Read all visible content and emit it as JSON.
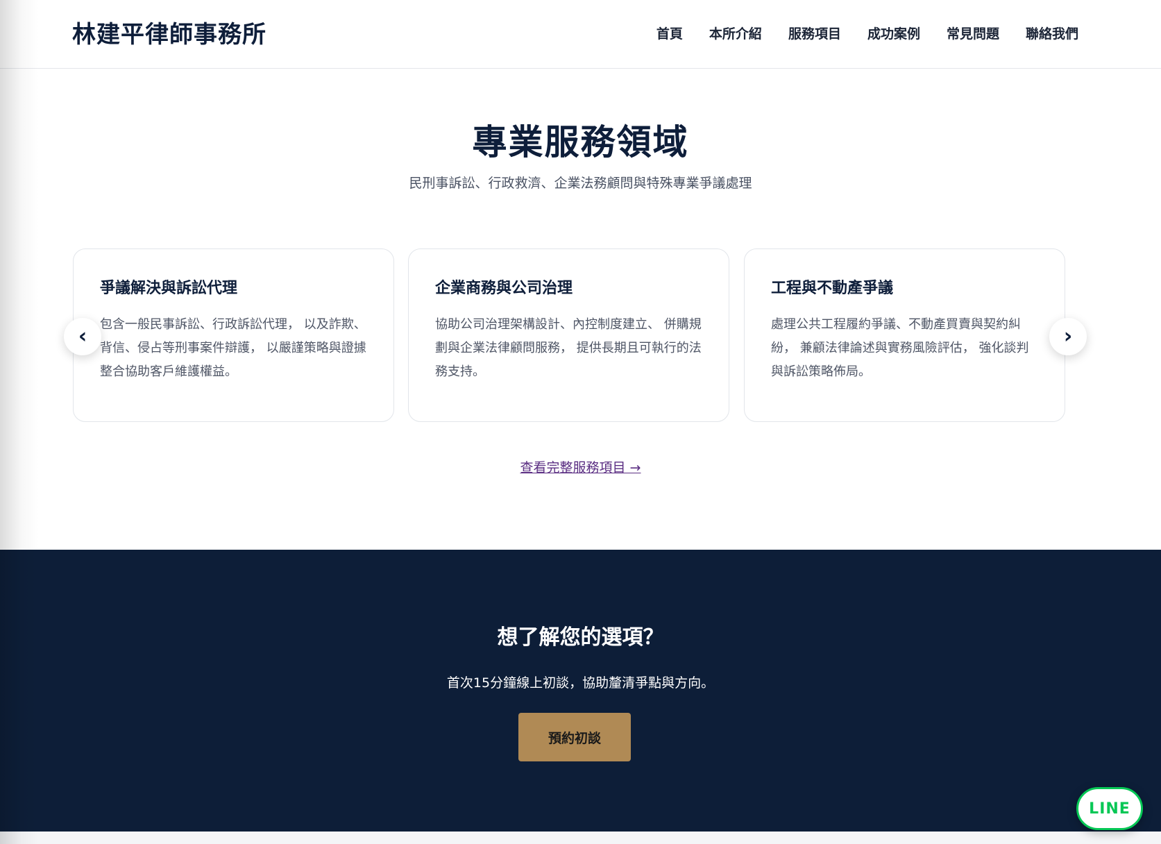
{
  "header": {
    "brand": "林建平律師事務所",
    "nav": [
      {
        "label": "首頁"
      },
      {
        "label": "本所介紹"
      },
      {
        "label": "服務項目"
      },
      {
        "label": "成功案例"
      },
      {
        "label": "常見問題"
      },
      {
        "label": "聯絡我們"
      }
    ]
  },
  "services": {
    "title": "專業服務領域",
    "subtitle": "民刑事訴訟、行政救濟、企業法務顧問與特殊專業爭議處理",
    "cards": [
      {
        "title": "爭議解決與訴訟代理",
        "description": "包含一般民事訴訟、行政訴訟代理， 以及詐欺、背信、侵占等刑事案件辯護， 以嚴謹策略與證據整合協助客戶維護權益。"
      },
      {
        "title": "企業商務與公司治理",
        "description": "協助公司治理架構設計、內控制度建立、 併購規劃與企業法律顧問服務， 提供長期且可執行的法務支持。"
      },
      {
        "title": "工程與不動產爭議",
        "description": "處理公共工程履約爭議、不動產買賣與契約糾紛， 兼顧法律論述與實務風險評估， 強化談判與訴訟策略佈局。"
      }
    ],
    "prev_arrow": "‹",
    "next_arrow": "›",
    "view_all_link": "查看完整服務項目 →"
  },
  "cta": {
    "title": "想了解您的選項？",
    "text": "首次15分鐘線上初談，協助釐清爭點與方向。",
    "button": "預約初談"
  },
  "floating": {
    "line_label": "LINE"
  },
  "colors": {
    "navy": "#0d1e38",
    "gold": "#b08a55",
    "line_green": "#06c755",
    "link_purple": "#5a2d82"
  }
}
